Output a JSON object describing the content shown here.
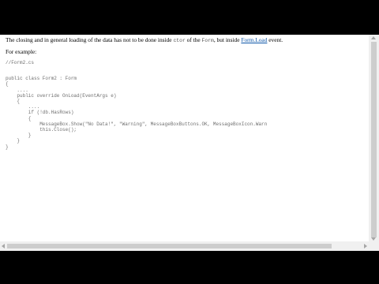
{
  "article": {
    "intro_part1": "The closing and in general loading of the data has not to be done inside ",
    "intro_code1": "ctor",
    "intro_part2": " of the ",
    "intro_code2": "Form",
    "intro_part3": ", but inside ",
    "intro_link": "Form.Load",
    "intro_part4": " event.",
    "example_label": "For example:",
    "code_comment": "//Form2.cs",
    "code_lines": [
      "public class Form2 : Form",
      "{",
      "    ....",
      "    public override OnLoad(EventArgs e)",
      "    {",
      "        ....",
      "        if (!db.HasRows)",
      "        {",
      "            MessageBox.Show(\"No Data!\", \"Warning\", MessageBoxButtons.OK, MessageBoxIcon.Warn",
      "            this.Close();",
      "        }",
      "    }",
      "}"
    ]
  },
  "colors": {
    "link": "#0b55a8",
    "code_text": "#6f6f6f",
    "background": "#ffffff",
    "letterbox": "#000000"
  }
}
